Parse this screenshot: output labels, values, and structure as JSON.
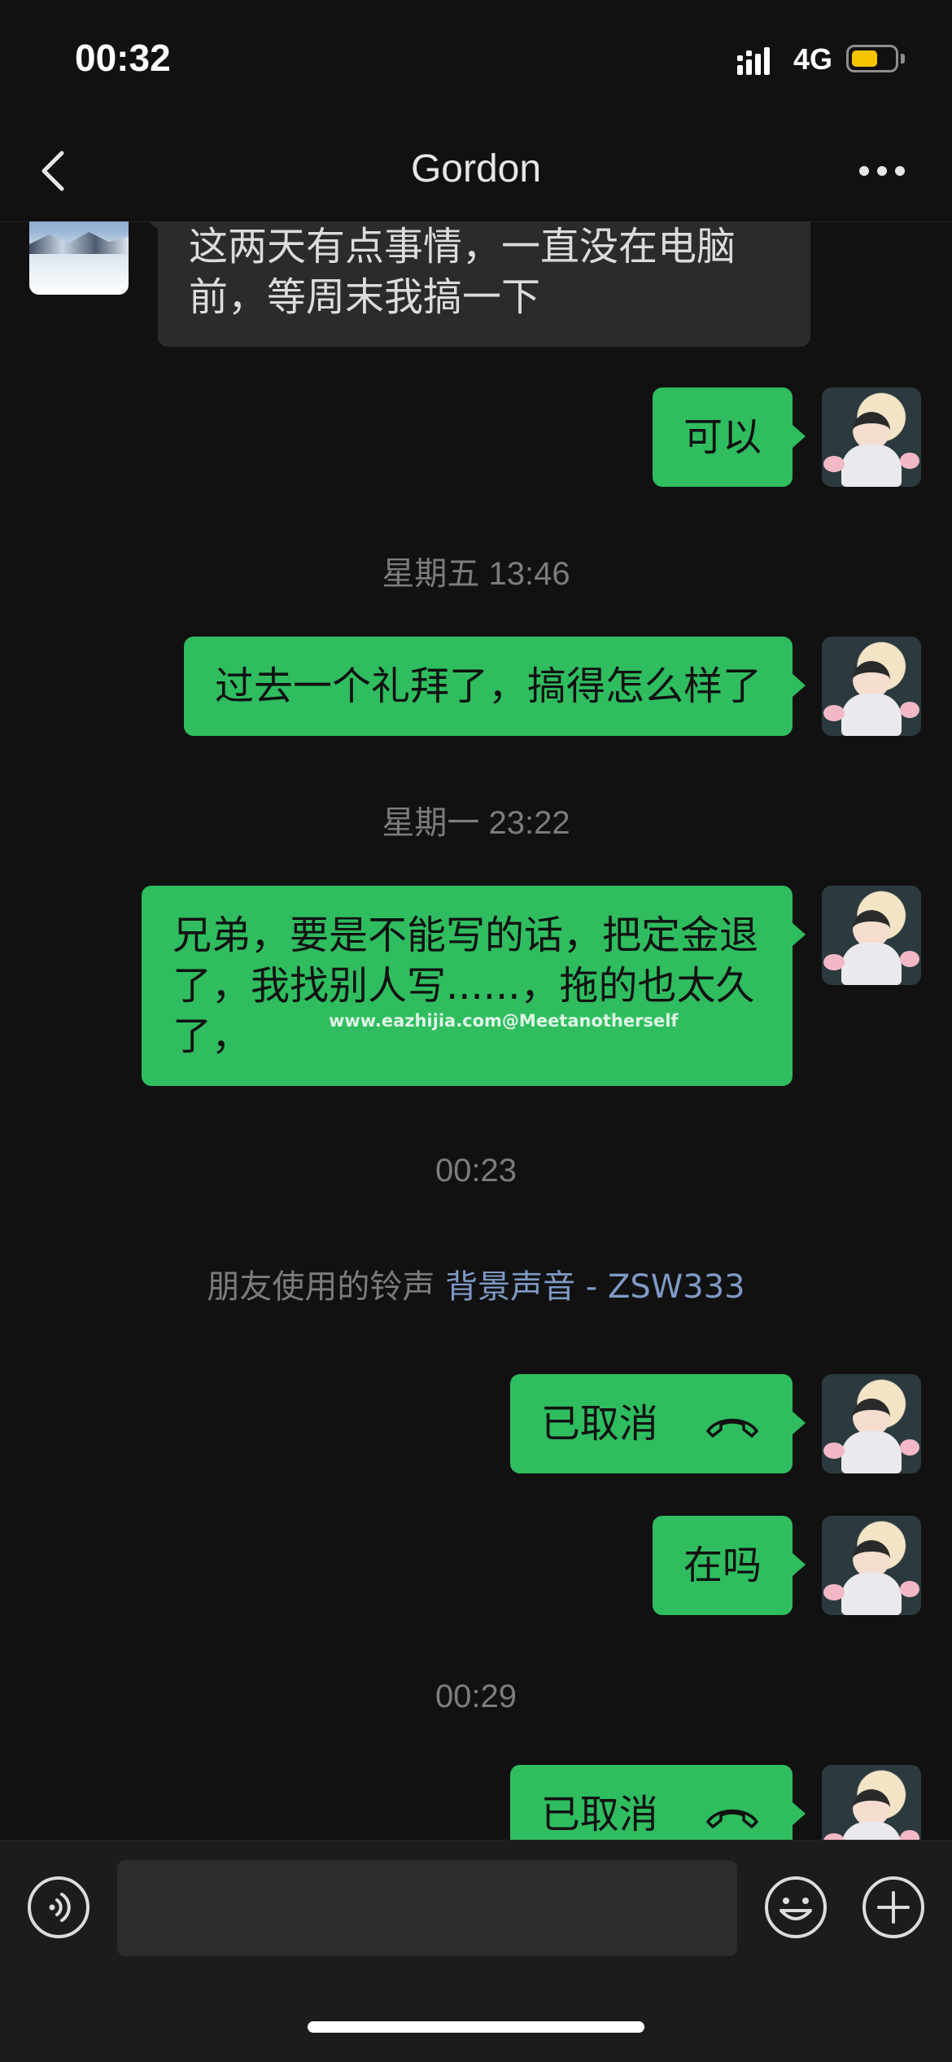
{
  "status_bar": {
    "time": "00:32",
    "network": "4G",
    "battery_level": 0.62,
    "battery_color": "#f5c400"
  },
  "nav": {
    "title": "Gordon",
    "back_icon": "chevron-left-icon",
    "more_icon": "more-horizontal-icon"
  },
  "messages": [
    {
      "sender": "friend",
      "text": "这两天有点事情，一直没在电脑前，等周末我搞一下"
    },
    {
      "sender": "me",
      "text": "可以"
    },
    {
      "type": "timestamp",
      "text": "星期五 13:46"
    },
    {
      "sender": "me",
      "text": "过去一个礼拜了，搞得怎么样了"
    },
    {
      "type": "timestamp",
      "text": "星期一 23:22"
    },
    {
      "sender": "me",
      "text": "兄弟，要是不能写的话，把定金退了，我找别人写......，拖的也太久了，",
      "watermark": "www.eazhijia.com@Meetanotherself"
    },
    {
      "type": "timestamp",
      "text": "00:23"
    },
    {
      "type": "system",
      "prefix": "朋友使用的铃声",
      "link": "背景声音 - ZSW333"
    },
    {
      "sender": "me",
      "type": "call",
      "text": "已取消",
      "icon": "phone-hangup-icon"
    },
    {
      "sender": "me",
      "text": "在吗"
    },
    {
      "type": "timestamp",
      "text": "00:29"
    },
    {
      "sender": "me",
      "type": "call",
      "text": "已取消",
      "icon": "phone-hangup-icon"
    }
  ],
  "input_bar": {
    "voice_icon": "voice-icon",
    "placeholder": "",
    "emoji_icon": "emoji-icon",
    "plus_icon": "plus-icon"
  },
  "colors": {
    "background": "#111111",
    "bubble_me": "#2fbd5f",
    "bubble_friend": "#2b2b2b",
    "link": "#7e9ac4"
  }
}
